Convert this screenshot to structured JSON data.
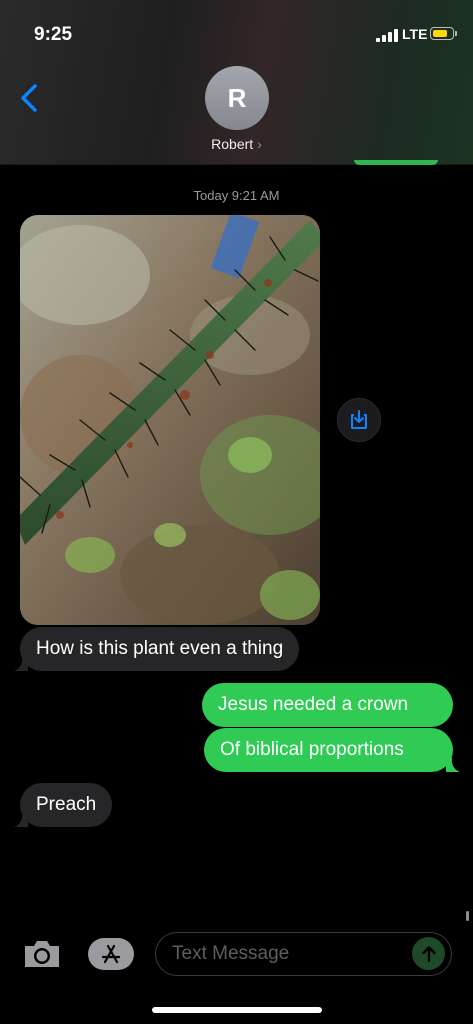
{
  "status_bar": {
    "time": "9:25",
    "network": "LTE",
    "battery_level": 0.6,
    "battery_color": "#ffd60a"
  },
  "header": {
    "back_icon": "chevron-left-icon",
    "avatar_initial": "R",
    "contact_name": "Robert",
    "contact_chevron": "›"
  },
  "thread": {
    "timestamp": "Today 9:21 AM",
    "photo_icon": "thorny-stem-photo",
    "save_icon": "save-download-icon",
    "messages": [
      {
        "direction": "received",
        "text": "How is this plant even a thing"
      },
      {
        "direction": "sent",
        "text": "Jesus needed a crown"
      },
      {
        "direction": "sent",
        "text": "Of biblical proportions"
      },
      {
        "direction": "received",
        "text": "Preach"
      }
    ]
  },
  "composer": {
    "camera_icon": "camera-icon",
    "apps_icon": "app-store-icon",
    "placeholder": "Text Message",
    "send_icon": "arrow-up-icon"
  },
  "colors": {
    "sent_bubble": "#2fcb55",
    "received_bubble": "#262628",
    "accent": "#0a84ff"
  }
}
